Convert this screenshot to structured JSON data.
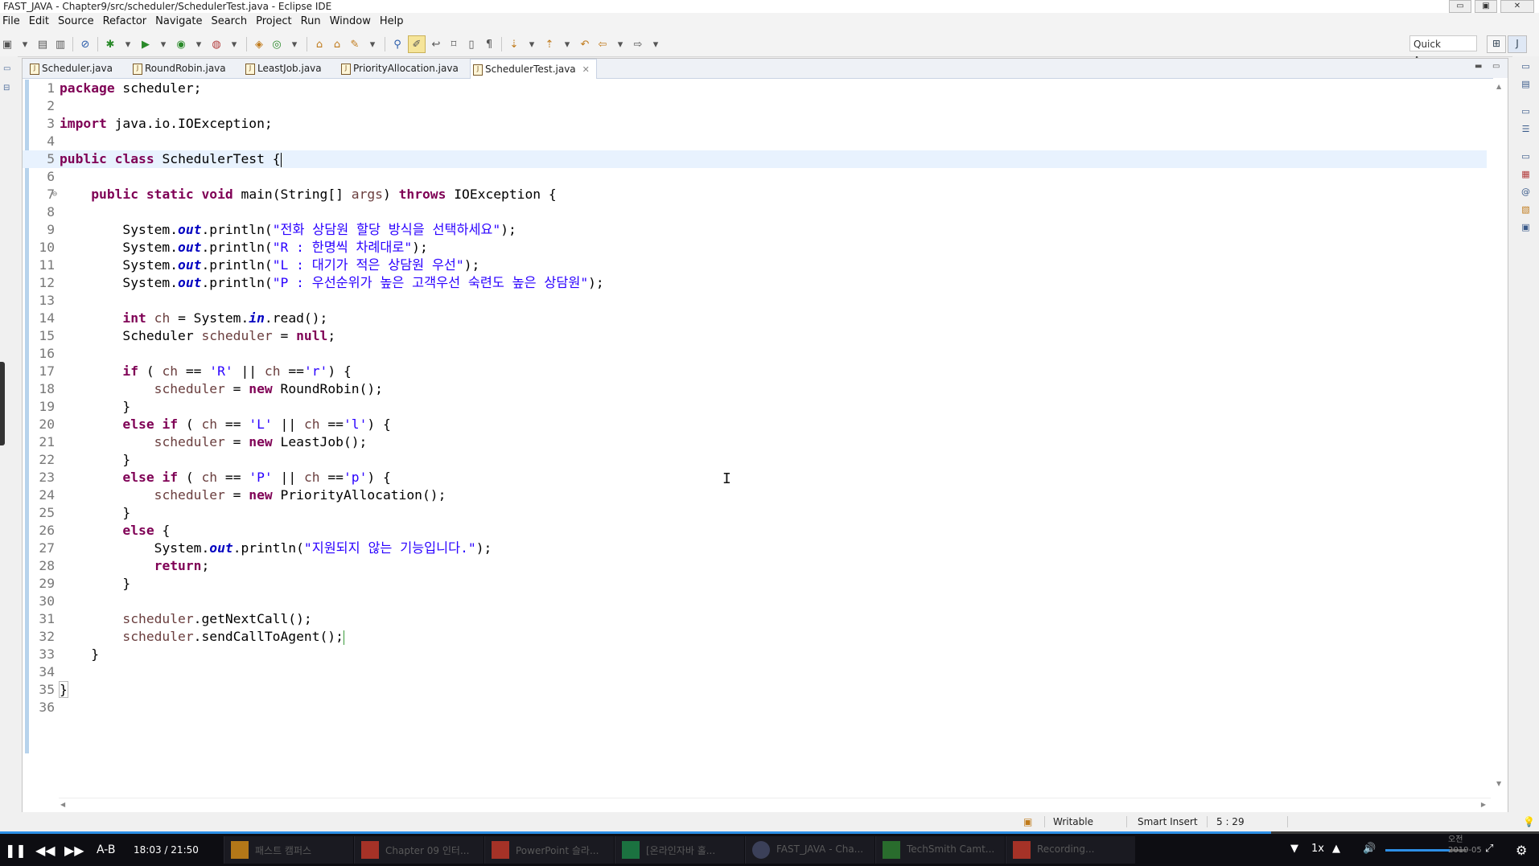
{
  "window": {
    "title": "FAST_JAVA - Chapter9/src/scheduler/SchedulerTest.java - Eclipse IDE",
    "controls": [
      "▭",
      "▣",
      "✕"
    ]
  },
  "menu": [
    "File",
    "Edit",
    "Source",
    "Refactor",
    "Navigate",
    "Search",
    "Project",
    "Run",
    "Window",
    "Help"
  ],
  "toolbar": {
    "quick_access": "Quick Access"
  },
  "tabs": [
    {
      "label": "Scheduler.java",
      "active": false
    },
    {
      "label": "RoundRobin.java",
      "active": false
    },
    {
      "label": "LeastJob.java",
      "active": false
    },
    {
      "label": "PriorityAllocation.java",
      "active": false
    },
    {
      "label": "SchedulerTest.java",
      "active": true
    }
  ],
  "tab_close": "✕",
  "editor": {
    "current_line": 5,
    "lines": [
      "1",
      "2",
      "3",
      "4",
      "5",
      "6",
      "7",
      "8",
      "9",
      "10",
      "11",
      "12",
      "13",
      "14",
      "15",
      "16",
      "17",
      "18",
      "19",
      "20",
      "21",
      "22",
      "23",
      "24",
      "25",
      "26",
      "27",
      "28",
      "29",
      "30",
      "31",
      "32",
      "33",
      "34",
      "35",
      "36"
    ],
    "tokens": {
      "package": "package",
      "pkgname": " scheduler;",
      "import": "import",
      "impname": " java.io.IOException;",
      "public": "public",
      "class": "class",
      "classname": " SchedulerTest {",
      "static": "static",
      "void": "void",
      "main_sig": " main(String[] ",
      "args": "args",
      "throws": "throws",
      "ioex": " IOException {",
      "system": "System.",
      "out": "out",
      "println_open": ".println(",
      "s1": "\"전화 상담원 할당 방식을 선택하세요\"",
      "s2": "\"R : 한명씩 차례대로\"",
      "s3": "\"L : 대기가 적은 상담원 우선\"",
      "s4": "\"P : 우선순위가 높은 고객우선 숙련도 높은 상담원\"",
      "s5": "\"지원되지 않는 기능입니다.\"",
      "close": ");",
      "int": "int",
      "ch": "ch",
      "assign_read1": " = System.",
      "in": "in",
      "read2": ".read();",
      "scheduler_type": "Scheduler ",
      "scheduler": "scheduler",
      "eq": " = ",
      "null": "null",
      "semi": ";",
      "if": "if",
      "else": "else",
      "paren_open": " ( ",
      "eqeq": " == ",
      "c_R": "'R'",
      "c_r": "'r'",
      "c_L": "'L'",
      "c_l": "'l'",
      "c_P": "'P'",
      "c_p": "'p'",
      "or": " || ",
      "eqeq2": " ==",
      "paren_close": ") {",
      "new": "new",
      "rr": " RoundRobin();",
      "lj": " LeastJob();",
      "pa": " PriorityAllocation();",
      "rbrace": "}",
      "else_brace": " {",
      "return": "return",
      "getnext": ".getNextCall();",
      "sendcall": ".sendCallToAgent();",
      "open_brace": " {",
      "lbrace_final": "}"
    }
  },
  "status": {
    "mode": "Writable",
    "insert": "Smart Insert",
    "position": "5 : 29"
  },
  "player": {
    "time_current": "18:03",
    "time_sep": "/",
    "time_total": "21:50",
    "ab": "A-B",
    "speed": "1x",
    "progress_fraction": 0.826,
    "volume_fraction": 0.8,
    "taskbar": [
      {
        "label": "패스트 캠퍼스",
        "color": "#d08a1a"
      },
      {
        "label": "Chapter 09 인터...",
        "color": "#c0392b"
      },
      {
        "label": "PowerPoint 슬라...",
        "color": "#c0392b"
      },
      {
        "label": "[온라인자바 홀...",
        "color": "#1e8449"
      },
      {
        "label": "FAST_JAVA - Cha...",
        "color": "#444a66"
      },
      {
        "label": "TechSmith Camt...",
        "color": "#2e7d32"
      },
      {
        "label": "Recording...",
        "color": "#c0392b"
      }
    ],
    "clock_line1": "오전",
    "clock_line2": "2019-05"
  },
  "colors": {
    "keyword": "#7f0055",
    "string": "#2a00ff",
    "field": "#0000c0",
    "local_var": "#6a3e3e",
    "current_line": "#e8f2fe",
    "accent": "#2d8fe6"
  }
}
